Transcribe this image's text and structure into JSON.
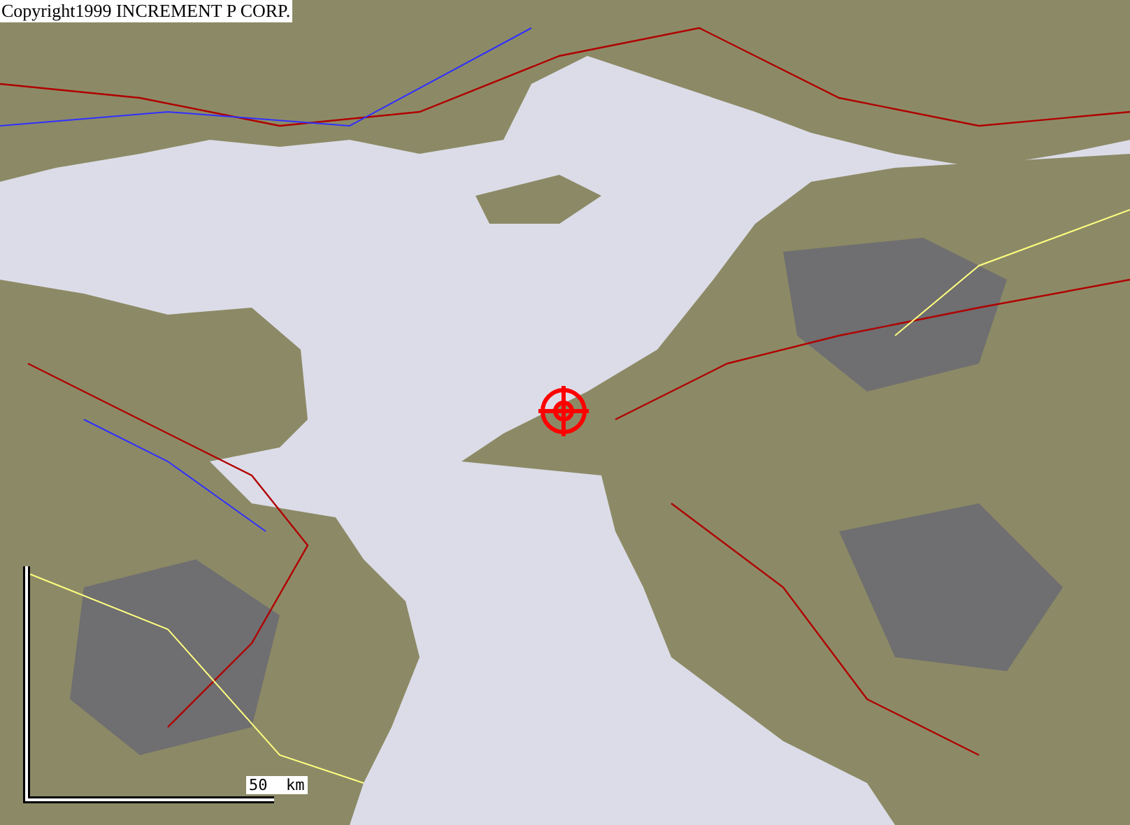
{
  "map": {
    "copyright": "Copyright1999 INCREMENT P CORP.",
    "scale_label": "50  km"
  }
}
